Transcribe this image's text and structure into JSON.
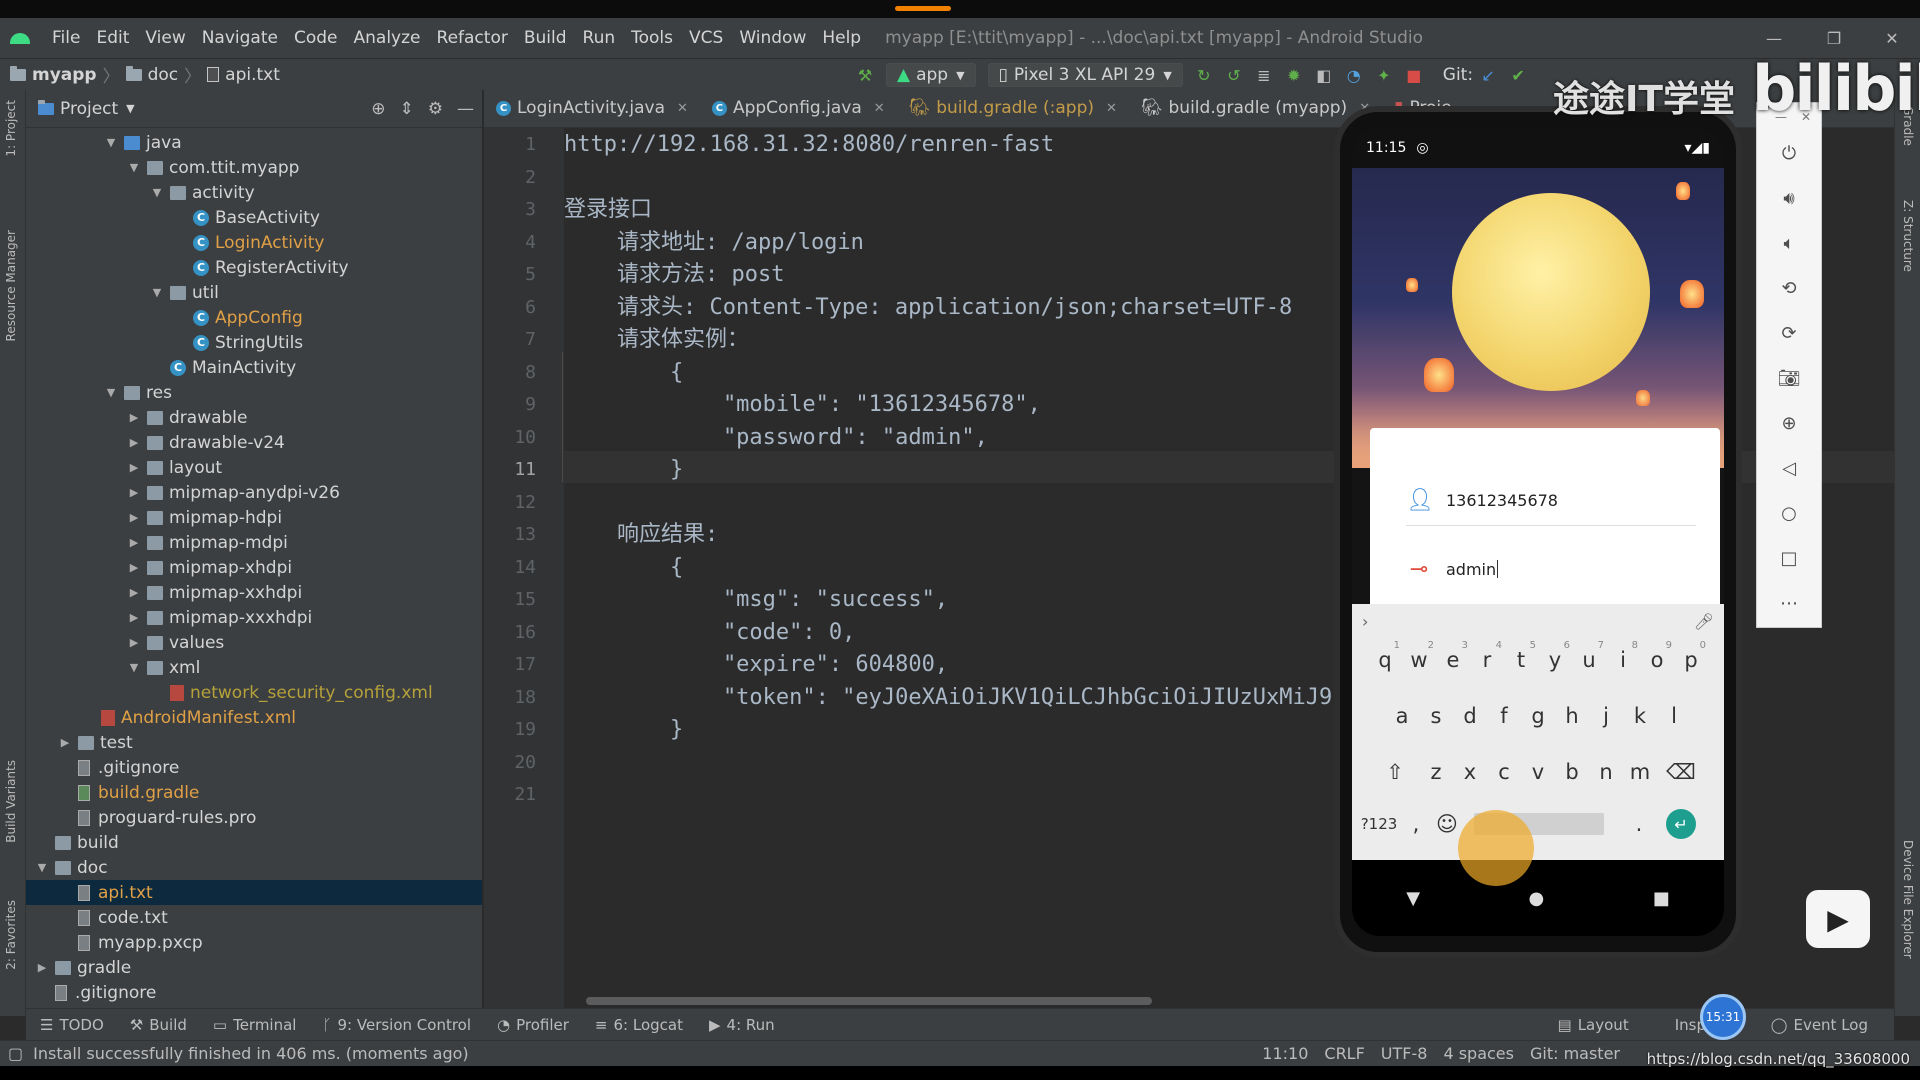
{
  "window": {
    "title": "myapp [E:\\ttit\\myapp] - ...\\doc\\api.txt [myapp] - Android Studio",
    "menu": [
      "File",
      "Edit",
      "View",
      "Navigate",
      "Code",
      "Analyze",
      "Refactor",
      "Build",
      "Run",
      "Tools",
      "VCS",
      "Window",
      "Help"
    ]
  },
  "breadcrumb": [
    "myapp",
    "doc",
    "api.txt"
  ],
  "toolbar": {
    "run_config": "app",
    "device": "Pixel 3 XL API 29",
    "git_label": "Git:"
  },
  "project_panel": {
    "title": "Project",
    "tree": [
      {
        "label": "java",
        "depth": 0,
        "icon": "folder-blue",
        "arrow": "▼"
      },
      {
        "label": "com.ttit.myapp",
        "depth": 1,
        "icon": "package",
        "arrow": "▼"
      },
      {
        "label": "activity",
        "depth": 2,
        "icon": "package",
        "arrow": "▼"
      },
      {
        "label": "BaseActivity",
        "depth": 3,
        "icon": "class",
        "arrow": ""
      },
      {
        "label": "LoginActivity",
        "depth": 3,
        "icon": "class",
        "arrow": "",
        "color": "orange"
      },
      {
        "label": "RegisterActivity",
        "depth": 3,
        "icon": "class",
        "arrow": ""
      },
      {
        "label": "util",
        "depth": 2,
        "icon": "package",
        "arrow": "▼"
      },
      {
        "label": "AppConfig",
        "depth": 3,
        "icon": "class",
        "arrow": "",
        "color": "orange"
      },
      {
        "label": "StringUtils",
        "depth": 3,
        "icon": "class",
        "arrow": ""
      },
      {
        "label": "MainActivity",
        "depth": 2,
        "icon": "class",
        "arrow": ""
      },
      {
        "label": "res",
        "depth": 0,
        "icon": "folder",
        "arrow": "▼"
      },
      {
        "label": "drawable",
        "depth": 1,
        "icon": "folder",
        "arrow": "▶"
      },
      {
        "label": "drawable-v24",
        "depth": 1,
        "icon": "folder",
        "arrow": "▶"
      },
      {
        "label": "layout",
        "depth": 1,
        "icon": "folder",
        "arrow": "▶"
      },
      {
        "label": "mipmap-anydpi-v26",
        "depth": 1,
        "icon": "folder",
        "arrow": "▶"
      },
      {
        "label": "mipmap-hdpi",
        "depth": 1,
        "icon": "folder",
        "arrow": "▶"
      },
      {
        "label": "mipmap-mdpi",
        "depth": 1,
        "icon": "folder",
        "arrow": "▶"
      },
      {
        "label": "mipmap-xhdpi",
        "depth": 1,
        "icon": "folder",
        "arrow": "▶"
      },
      {
        "label": "mipmap-xxhdpi",
        "depth": 1,
        "icon": "folder",
        "arrow": "▶"
      },
      {
        "label": "mipmap-xxxhdpi",
        "depth": 1,
        "icon": "folder",
        "arrow": "▶"
      },
      {
        "label": "values",
        "depth": 1,
        "icon": "folder",
        "arrow": "▶"
      },
      {
        "label": "xml",
        "depth": 1,
        "icon": "folder",
        "arrow": "▼"
      },
      {
        "label": "network_security_config.xml",
        "depth": 2,
        "icon": "xml",
        "arrow": "",
        "color": "olive"
      },
      {
        "label": "AndroidManifest.xml",
        "depth": -1,
        "icon": "xml",
        "arrow": "",
        "color": "orange"
      },
      {
        "label": "test",
        "depth": -2,
        "icon": "folder",
        "arrow": "▶"
      },
      {
        "label": ".gitignore",
        "depth": -2,
        "icon": "file",
        "arrow": ""
      },
      {
        "label": "build.gradle",
        "depth": -2,
        "icon": "gradle",
        "arrow": "",
        "color": "orange"
      },
      {
        "label": "proguard-rules.pro",
        "depth": -2,
        "icon": "file",
        "arrow": ""
      },
      {
        "label": "build",
        "depth": -3,
        "icon": "folder",
        "arrow": ""
      },
      {
        "label": "doc",
        "depth": -3,
        "icon": "folder",
        "arrow": "▼"
      },
      {
        "label": "api.txt",
        "depth": -2,
        "icon": "file",
        "arrow": "",
        "color": "orange",
        "selected": true
      },
      {
        "label": "code.txt",
        "depth": -2,
        "icon": "file",
        "arrow": ""
      },
      {
        "label": "myapp.pxcp",
        "depth": -2,
        "icon": "file",
        "arrow": ""
      },
      {
        "label": "gradle",
        "depth": -3,
        "icon": "folder",
        "arrow": "▶"
      },
      {
        "label": ".gitignore",
        "depth": -3,
        "icon": "file",
        "arrow": ""
      }
    ]
  },
  "editor_tabs": [
    {
      "label": "LoginActivity.java",
      "icon": "class",
      "active": false
    },
    {
      "label": "AppConfig.java",
      "icon": "class",
      "active": false
    },
    {
      "label": "build.gradle (:app)",
      "icon": "gradle",
      "active": false,
      "modified": true
    },
    {
      "label": "build.gradle (myapp)",
      "icon": "gradle",
      "active": false
    },
    {
      "label": "Proje",
      "icon": "file",
      "active": false
    }
  ],
  "code_lines": [
    "http://192.168.31.32:8080/renren-fast",
    "",
    "登录接口",
    "    请求地址: /app/login",
    "    请求方法: post",
    "    请求头: Content-Type: application/json;charset=UTF-8",
    "    请求体实例：",
    "        {",
    "            \"mobile\": \"13612345678\",",
    "            \"password\": \"admin\",",
    "        }",
    "",
    "    响应结果:",
    "        {",
    "            \"msg\": \"success\",",
    "            \"code\": 0,",
    "            \"expire\": 604800,",
    "            \"token\": \"eyJ0eXAiOiJKV1QiLCJhbGciOiJIUzUxMiJ9.eyJzdWIiOiIxIiwiaWF0IjoxNTkyMDQ0MzE",
    "        }",
    "",
    ""
  ],
  "phone": {
    "time": "11:15",
    "mobile_value": "13612345678",
    "password_value": "admin",
    "keyboard": {
      "row1": [
        [
          "q",
          "1"
        ],
        [
          "w",
          "2"
        ],
        [
          "e",
          "3"
        ],
        [
          "r",
          "4"
        ],
        [
          "t",
          "5"
        ],
        [
          "y",
          "6"
        ],
        [
          "u",
          "7"
        ],
        [
          "i",
          "8"
        ],
        [
          "o",
          "9"
        ],
        [
          "p",
          "0"
        ]
      ],
      "row2": [
        "a",
        "s",
        "d",
        "f",
        "g",
        "h",
        "j",
        "k",
        "l"
      ],
      "row3": [
        "⇧",
        "z",
        "x",
        "c",
        "v",
        "b",
        "n",
        "m",
        "⌫"
      ],
      "row4_left": "?123",
      "row4_comma": ",",
      "row4_period": "."
    }
  },
  "watermark": {
    "site": "途途IT学堂",
    "brand": "bilibili"
  },
  "bottom_tools": [
    {
      "label": "TODO",
      "icon": "list-icon"
    },
    {
      "label": "Build",
      "icon": "hammer-icon"
    },
    {
      "label": "Terminal",
      "icon": "terminal-icon"
    },
    {
      "label": "9: Version Control",
      "icon": "branch-icon"
    },
    {
      "label": "Profiler",
      "icon": "gauge-icon"
    },
    {
      "label": "6: Logcat",
      "icon": "logcat-icon"
    },
    {
      "label": "4: Run",
      "icon": "play-icon"
    }
  ],
  "bottom_right_tools": [
    "Layout",
    "Inspector",
    "Event Log"
  ],
  "status": {
    "message": "Install successfully finished in 406 ms. (moments ago)",
    "position": "11:10",
    "line_sep": "CRLF",
    "encoding": "UTF-8",
    "indent": "4 spaces",
    "git": "Git: master"
  },
  "overlay": {
    "clock": "15:31",
    "url": "https://blog.csdn.net/qq_33608000"
  },
  "left_strip": [
    "1: Project",
    "Resource Manager",
    "Build Variants",
    "2: Favorites"
  ],
  "right_strip": [
    "Gradle",
    "Z: Structure",
    "Device File Explorer"
  ]
}
